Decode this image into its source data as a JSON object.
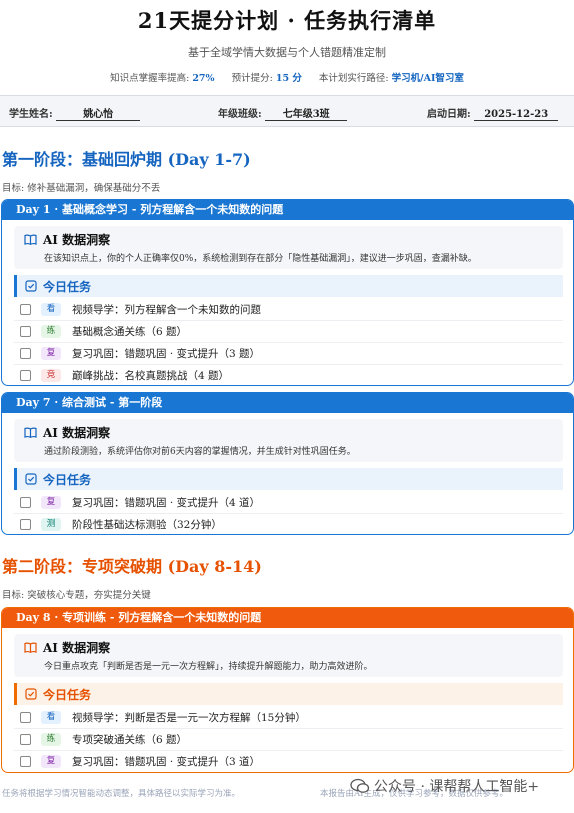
{
  "header": {
    "title": "21天提分计划 · 任务执行清单",
    "subtitle": "基于全域学情大数据与个人错题精准定制",
    "stats": [
      {
        "label": "知识点掌握率提高:",
        "value": "27%"
      },
      {
        "label": "预计提分:",
        "value": "15 分"
      },
      {
        "label": "本计划实行路径:",
        "value": "学习机/AI智习室"
      }
    ]
  },
  "info": {
    "name_label": "学生姓名:",
    "name_value": "姚心怡",
    "grade_label": "年级班级:",
    "grade_value": "七年级3班",
    "date_label": "启动日期:",
    "date_value": "2025-12-23"
  },
  "phase1": {
    "title": "第一阶段：基础回炉期 (Day 1-7)",
    "goal": "目标: 修补基础漏洞，确保基础分不丢",
    "day1": {
      "head": "Day 1 · 基础概念学习 - 列方程解含一个未知数的问题",
      "insight_title": "AI 数据洞察",
      "insight_text": "在该知识点上，你的个人正确率仅0%，系统检测到存在部分「隐性基础漏洞」，建议进一步巩固，查漏补缺。",
      "task_title": "今日任务",
      "tasks": [
        {
          "tag": "看",
          "text": "视频导学：列方程解含一个未知数的问题"
        },
        {
          "tag": "练",
          "text": "基础概念通关练（6 题）"
        },
        {
          "tag": "复",
          "text": "复习巩固：错题巩固 · 变式提升（3 题）"
        },
        {
          "tag": "竞",
          "text": "巅峰挑战：名校真题挑战（4 题）"
        }
      ]
    },
    "day7": {
      "head": "Day 7 · 综合测试 - 第一阶段",
      "insight_title": "AI 数据洞察",
      "insight_text": "通过阶段测验，系统评估你对前6天内容的掌握情况，并生成针对性巩固任务。",
      "task_title": "今日任务",
      "tasks": [
        {
          "tag": "复",
          "text": "复习巩固：错题巩固 · 变式提升（4 道）"
        },
        {
          "tag": "测",
          "text": "阶段性基础达标测验（32分钟）"
        }
      ]
    }
  },
  "phase2": {
    "title": "第二阶段：专项突破期 (Day 8-14)",
    "goal": "目标: 突破核心专题，夯实提分关键",
    "day8": {
      "head": "Day 8 · 专项训练 - 列方程解含一个未知数的问题",
      "insight_title": "AI 数据洞察",
      "insight_text": "今日重点攻克「判断是否是一元一次方程解」，持续提升解题能力，助力高效进阶。",
      "task_title": "今日任务",
      "tasks": [
        {
          "tag": "看",
          "text": "视频导学：判断是否是一元一次方程解（15分钟）"
        },
        {
          "tag": "练",
          "text": "专项突破通关练（6 题）"
        },
        {
          "tag": "复",
          "text": "复习巩固：错题巩固 · 变式提升（3 道）"
        }
      ]
    }
  },
  "footer": {
    "left": "任务将根据学习情况智能动态调整，具体路径以实际学习为准。",
    "right": "本报告由AI生成，仅供学习参考，数据仅供参考。"
  },
  "watermark": "公众号 · 课帮帮人工智能+",
  "colors": {
    "blue": "#1976d2",
    "orange": "#ef5a0c"
  }
}
